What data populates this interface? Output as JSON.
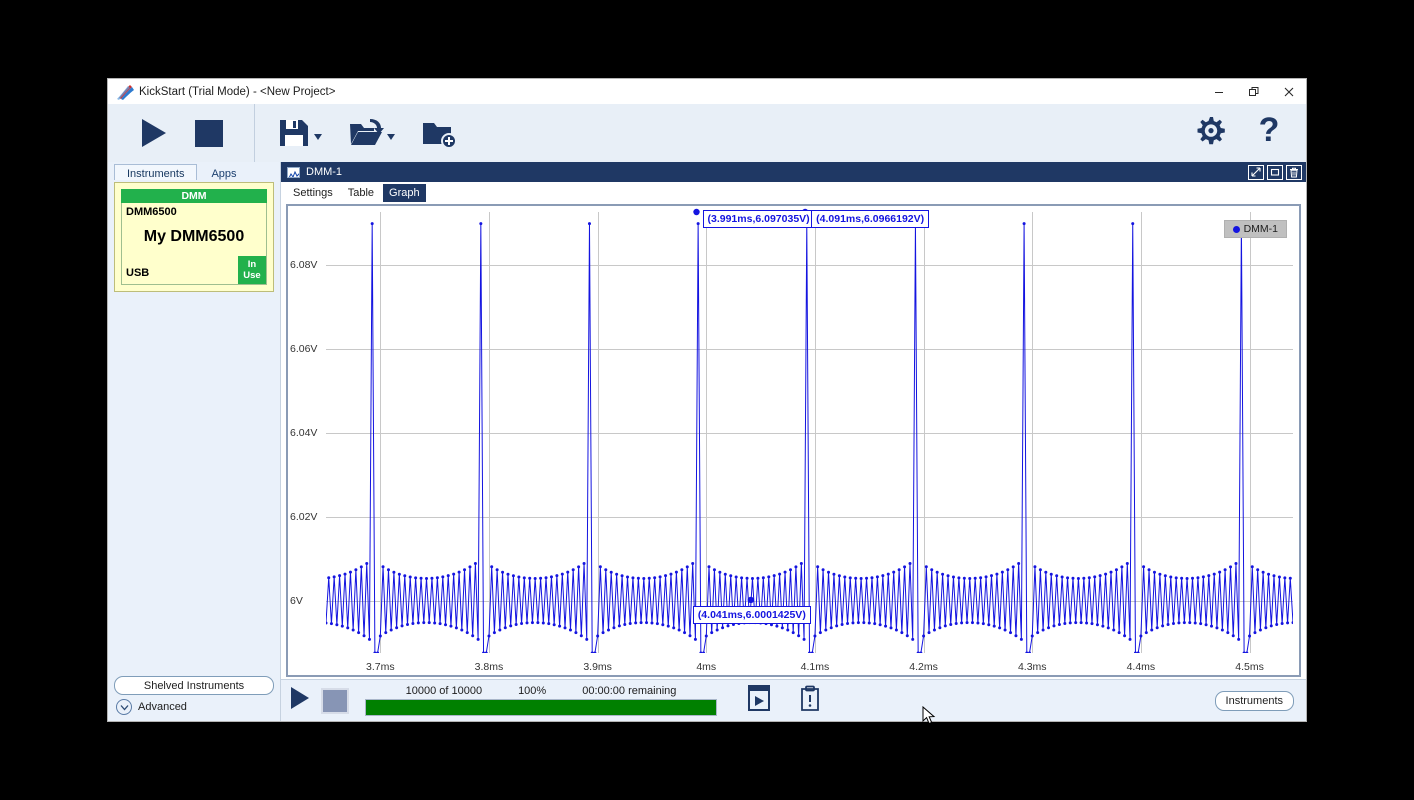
{
  "window": {
    "title": "KickStart (Trial Mode) - <New Project>",
    "app_icon": "kickstart-logo-icon",
    "controls": [
      {
        "name": "minimize",
        "glyph": "—"
      },
      {
        "name": "restore",
        "glyph": "❐"
      },
      {
        "name": "close",
        "glyph": "✕"
      }
    ]
  },
  "toolbar": {
    "run_label": "run-button",
    "stop_label": "stop-button",
    "save_label": "save-button",
    "open_label": "open-button",
    "new_project_label": "new-project-button",
    "settings_label": "settings-button",
    "help_label": "help-button",
    "accent": "#1f3864",
    "background": "#e8eff7"
  },
  "sidebar": {
    "tabs": [
      {
        "label": "Instruments",
        "active": true
      },
      {
        "label": "Apps",
        "active": false
      }
    ],
    "instrument": {
      "category": "DMM",
      "model": "DMM6500",
      "name": "My DMM6500",
      "connection": "USB",
      "status": "In Use",
      "status_color": "#22b14c",
      "card_color": "#ffffcc"
    },
    "shelved_button": "Shelved Instruments",
    "advanced_label": "Advanced"
  },
  "panel": {
    "title": "DMM-1",
    "header_color": "#1f3864",
    "buttons": [
      {
        "name": "expand",
        "glyph": "⤡"
      },
      {
        "name": "restore",
        "glyph": "□"
      },
      {
        "name": "delete",
        "glyph": "Ὕ1"
      }
    ],
    "tabs": [
      {
        "label": "Settings",
        "active": false
      },
      {
        "label": "Table",
        "active": false
      },
      {
        "label": "Graph",
        "active": true
      }
    ]
  },
  "chart_data": {
    "type": "line",
    "title": "",
    "xlabel": "",
    "ylabel": "",
    "series_name": "DMM-1",
    "series_color": "#1414e0",
    "legend_position": "top-right",
    "grid": true,
    "xlim": [
      3.65,
      4.54
    ],
    "ylim": [
      5.9875,
      6.0925
    ],
    "xticks": [
      "3.7ms",
      "3.8ms",
      "3.9ms",
      "4ms",
      "4.1ms",
      "4.2ms",
      "4.3ms",
      "4.4ms",
      "4.5ms"
    ],
    "xtick_values": [
      3.7,
      3.8,
      3.9,
      4.0,
      4.1,
      4.2,
      4.3,
      4.4,
      4.5
    ],
    "yticks": [
      "6V",
      "6.02V",
      "6.04V",
      "6.06V",
      "6.08V"
    ],
    "ytick_values": [
      6.0,
      6.02,
      6.04,
      6.06,
      6.08
    ],
    "waveform": {
      "description": "Damped ringing oscillation around 6V with periodic sharp spikes reaching ~6.097V",
      "baseline_v": 6.0,
      "spike_peak_v": 6.097,
      "spike_period_ms": 0.1,
      "spike_times_ms": [
        3.691,
        3.791,
        3.891,
        3.991,
        4.091,
        4.191,
        4.291,
        4.391,
        4.491
      ],
      "ring_amplitude_v": 0.0035,
      "sample_period_ms": 0.0025
    },
    "annotations": [
      {
        "label": "(3.991ms,6.097035V)",
        "x": 3.991,
        "y": 6.097035
      },
      {
        "label": "(4.091ms,6.0966192V)",
        "x": 4.091,
        "y": 6.0966192
      },
      {
        "label": "(4.041ms,6.0001425V)",
        "x": 4.041,
        "y": 6.0001425
      }
    ],
    "legend": [
      {
        "name": "DMM-1",
        "color": "#1414e0"
      }
    ]
  },
  "statusbar": {
    "run_label": "run-button",
    "stop_label": "stop-button",
    "count": "10000 of 10000",
    "percent": "100%",
    "remaining": "00:00:00 remaining",
    "progress_value": 100,
    "progress_color": "#008000",
    "export_label": "export-button",
    "log_label": "log-button",
    "instruments_button": "Instruments"
  }
}
